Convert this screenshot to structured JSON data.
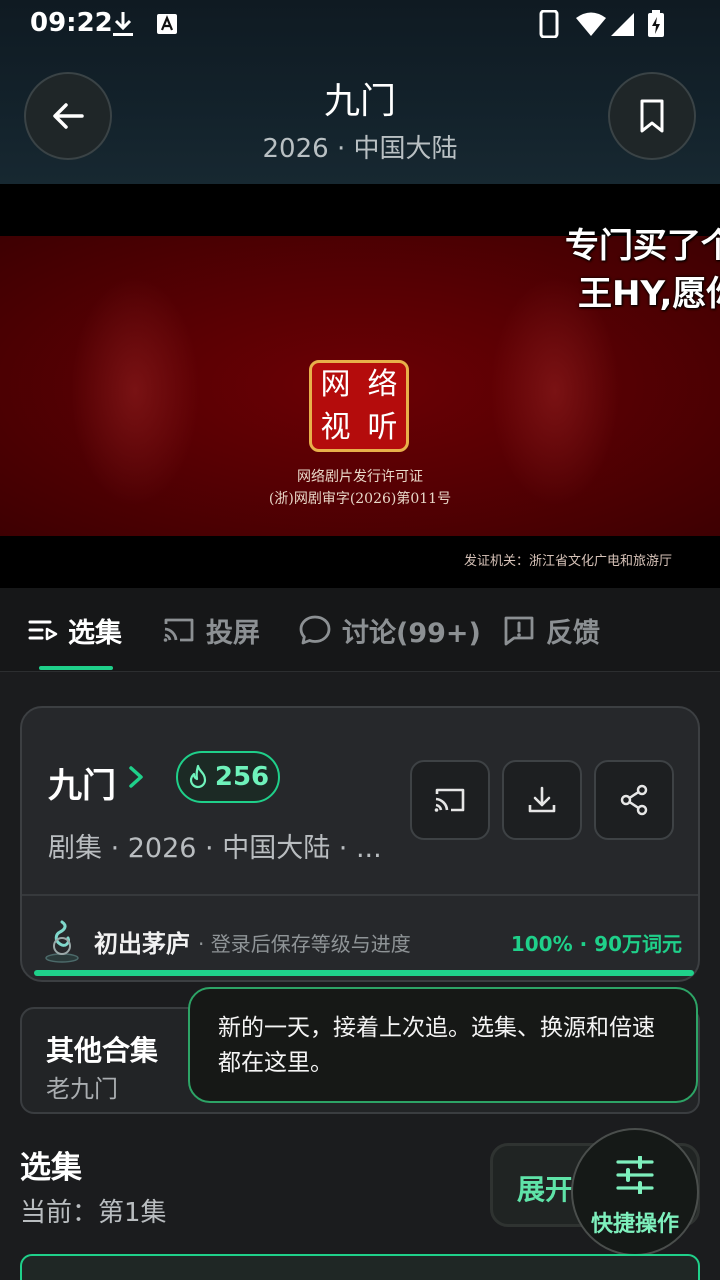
{
  "status_bar": {
    "time": "09:22",
    "icons": [
      "download-icon",
      "keyboard-a-icon",
      "phone-icon",
      "wifi-icon",
      "signal-icon",
      "battery-charging-icon"
    ]
  },
  "header": {
    "title": "九门",
    "subtitle": "2026 · 中国大陆",
    "back_icon": "arrow-left-icon",
    "bookmark_icon": "bookmark-icon"
  },
  "video": {
    "seal_chars": [
      "网",
      "络",
      "视",
      "听"
    ],
    "license_line1": "网络剧片发行许可证",
    "license_line2": "(浙)网剧审字(2026)第011号",
    "issuer": "发证机关：浙江省文化广电和旅游厅",
    "danmaku_line1": "专门买了个",
    "danmaku_line2": "王HY,愿你"
  },
  "tabs": [
    {
      "label": "选集",
      "icon": "episodes-icon",
      "active": true
    },
    {
      "label": "投屏",
      "icon": "cast-icon",
      "active": false
    },
    {
      "label": "讨论(99+)",
      "icon": "comment-icon",
      "active": false
    },
    {
      "label": "反馈",
      "icon": "feedback-icon",
      "active": false
    }
  ],
  "show_card": {
    "title": "九门",
    "heat": "256",
    "meta": "剧集 · 2026 · 中国大陆 · ...",
    "actions": [
      "cast-icon",
      "download-icon",
      "share-icon"
    ],
    "level_name": "初出茅庐",
    "level_hint": "· 登录后保存等级与进度",
    "level_progress": "100% · 90万词元",
    "accent": "#1fd08a"
  },
  "collection": {
    "title": "其他合集",
    "subtitle": "老九门"
  },
  "tooltip": {
    "text": "新的一天，接着上次追。选集、换源和倍速都在这里。"
  },
  "episodes": {
    "title": "选集",
    "current": "当前：第1集",
    "expand_label": "展开",
    "quick_label": "快捷操作"
  }
}
